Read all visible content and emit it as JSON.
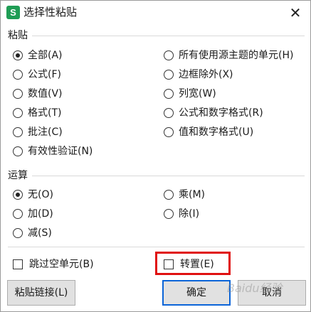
{
  "window": {
    "icon_letter": "S",
    "title": "选择性粘贴",
    "close_glyph": "✕"
  },
  "paste": {
    "label": "粘贴",
    "options": [
      {
        "label": "全部(A)",
        "checked": true
      },
      {
        "label": "公式(F)",
        "checked": false
      },
      {
        "label": "数值(V)",
        "checked": false
      },
      {
        "label": "格式(T)",
        "checked": false
      },
      {
        "label": "批注(C)",
        "checked": false
      },
      {
        "label": "有效性验证(N)",
        "checked": false
      },
      {
        "label": "所有使用源主题的单元(H)",
        "checked": false
      },
      {
        "label": "边框除外(X)",
        "checked": false
      },
      {
        "label": "列宽(W)",
        "checked": false
      },
      {
        "label": "公式和数字格式(R)",
        "checked": false
      },
      {
        "label": "值和数字格式(U)",
        "checked": false
      }
    ]
  },
  "operation": {
    "label": "运算",
    "options": [
      {
        "label": "无(O)",
        "checked": true
      },
      {
        "label": "加(D)",
        "checked": false
      },
      {
        "label": "减(S)",
        "checked": false
      },
      {
        "label": "乘(M)",
        "checked": false
      },
      {
        "label": "除(I)",
        "checked": false
      }
    ]
  },
  "checkboxes": {
    "skip_blanks": {
      "label": "跳过空单元(B)",
      "checked": false
    },
    "transpose": {
      "label": "转置(E)",
      "checked": false
    }
  },
  "buttons": {
    "paste_link": "粘贴链接(L)",
    "ok": "确定",
    "cancel": "取消"
  },
  "watermark": "Baidu经验",
  "colors": {
    "highlight": "#e01010",
    "primary_border": "#0a64d8",
    "app_icon": "#1f9d55"
  }
}
